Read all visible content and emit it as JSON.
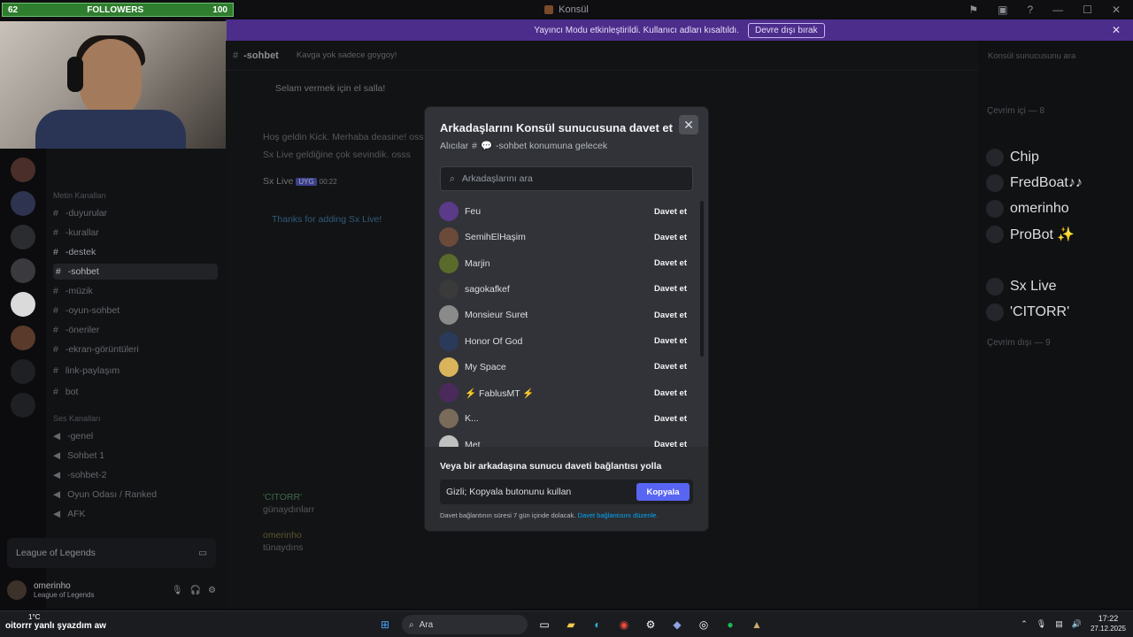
{
  "window": {
    "title": "Konsül"
  },
  "stream": {
    "followers_label": "FOLLOWERS",
    "followers_current": "62",
    "followers_goal": "100"
  },
  "banner": {
    "text": "Yayıncı Modu etkinleştirildi. Kullanıcı adları kısaltıldı.",
    "button": "Devre dışı bırak"
  },
  "channel": {
    "name": "-sohbet",
    "topic": "Kavga yok sadece goygoy!",
    "search_placeholder": "Konsül sunucusunu ara"
  },
  "sidebar": {
    "category_text": "Metin Kanalları",
    "category_voice": "Ses Kanalları",
    "text_channels": [
      "-duyurular",
      "-kurallar",
      "-destek",
      "-sohbet",
      "-müzik",
      "-oyun-sohbet",
      "-öneriler",
      "-ekran-görüntüleri",
      "link-paylaşım",
      "bot"
    ],
    "voice_channels": [
      "-genel",
      "Sohbet 1",
      "-sohbet-2",
      "Oyun Odası / Ranked",
      "AFK"
    ],
    "voice_status": "League of Legends",
    "user": "omerinho",
    "user_status": "League of Legends"
  },
  "chat": {
    "line1": "Selam vermek için el salla!",
    "line2": "Hoş geldin Kick. Merhaba deasine! osss",
    "line3": "Sx Live geldiğine çok sevindik. osss",
    "bot_name": "Sx Live",
    "bot_tag": "UYG",
    "bot_time": "00:22",
    "embed_title": "Thanks for adding Sx Live!",
    "msg_user1": "'CITORR'",
    "msg_text1": "günaydınlarr",
    "msg_user2": "omerinho",
    "msg_text2": "tünaydıns"
  },
  "members": {
    "online": "Çevrim içi — 8",
    "offline": "Çevrim dışı — 9",
    "list": [
      "Chip",
      "FredBoat♪♪",
      "omerinho",
      "ProBot ✨",
      "Sx Live",
      "'CITORR'"
    ]
  },
  "modal": {
    "title": "Arkadaşlarını Konsül sunucusuna davet et",
    "recipients_label": "Alıcılar",
    "recipients_channel": "-sohbet konumuna gelecek",
    "search_placeholder": "Arkadaşlarını ara",
    "invite_label": "Davet et",
    "friends": [
      {
        "name": "Feu",
        "color": "#5b3a8a"
      },
      {
        "name": "SemihElHaşim",
        "color": "#6b4a3a"
      },
      {
        "name": "Marjin",
        "color": "#5a6a2a"
      },
      {
        "name": "sagokafkef",
        "color": "#3a3a3a"
      },
      {
        "name": "Monsieur Sureŧ",
        "color": "#8a8a8a"
      },
      {
        "name": "Honor Of God",
        "color": "#2a3a5a"
      },
      {
        "name": "My Space",
        "color": "#d9b45a"
      },
      {
        "name": "⚡ FablusMT ⚡",
        "color": "#4a2a5a"
      },
      {
        "name": "K...",
        "color": "#7a6a5a"
      },
      {
        "name": "Met",
        "color": "#c0c0c0"
      }
    ],
    "footer_title": "Veya bir arkadaşına sunucu daveti bağlantısı yolla",
    "link_value": "Gizli; Kopyala butonunu kullan",
    "copy_label": "Kopyala",
    "note": "Davet bağlantının süresi 7 gün içinde dolacak.",
    "note_link": "Davet bağlantısını düzenle."
  },
  "taskbar": {
    "weather": "1°C",
    "ticker": "oitorrr yanlı şyazdım aw",
    "search": "Ara",
    "time": "17:22",
    "date": "27.12.2025"
  }
}
